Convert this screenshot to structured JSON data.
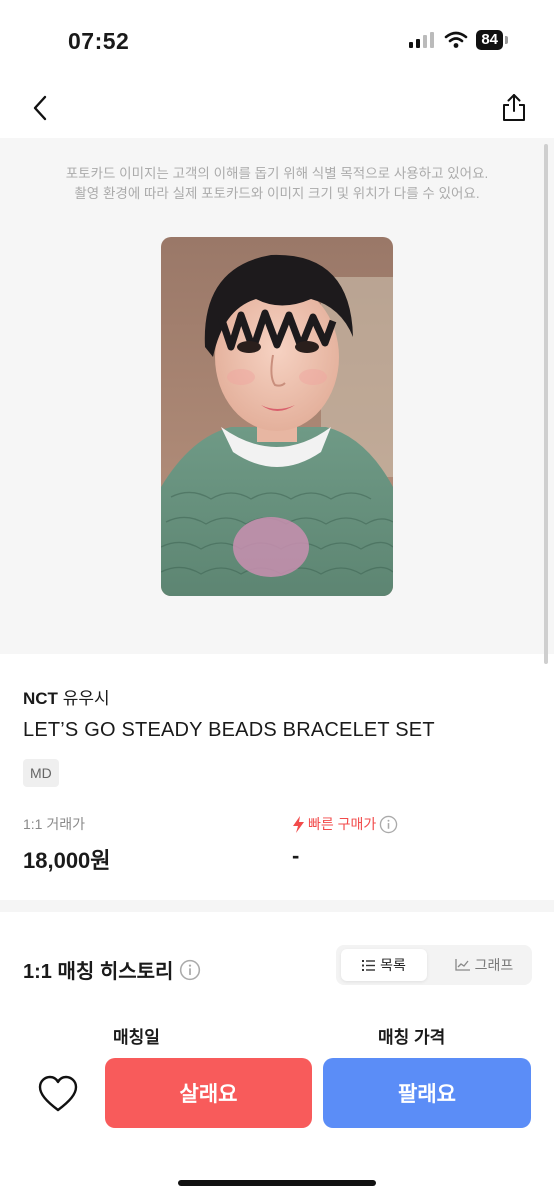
{
  "status_bar": {
    "time": "07:52",
    "battery": "84"
  },
  "notice": {
    "line1": "포토카드 이미지는 고객의 이해를 돕기 위해 식별 목적으로 사용하고 있어요.",
    "line2": "촬영 환경에 따라 실제 포토카드와 이미지 크기 및 위치가 다를 수 있어요."
  },
  "product": {
    "group": "NCT",
    "member": "유우시",
    "name": "LET’S GO STEADY BEADS BRACELET SET",
    "category": "MD"
  },
  "prices": {
    "trade_label": "1:1 거래가",
    "trade_value": "18,000원",
    "fast_label": "빠른 구매가",
    "fast_value": "-"
  },
  "history": {
    "title": "1:1 매칭 히스토리",
    "toggle_list": "목록",
    "toggle_graph": "그래프",
    "col_date": "매칭일",
    "col_price": "매칭 가격"
  },
  "actions": {
    "buy": "살래요",
    "sell": "팔래요"
  },
  "colors": {
    "buy": "#f85b5b",
    "sell": "#5b8df7",
    "fast_accent": "#f24b4b"
  }
}
